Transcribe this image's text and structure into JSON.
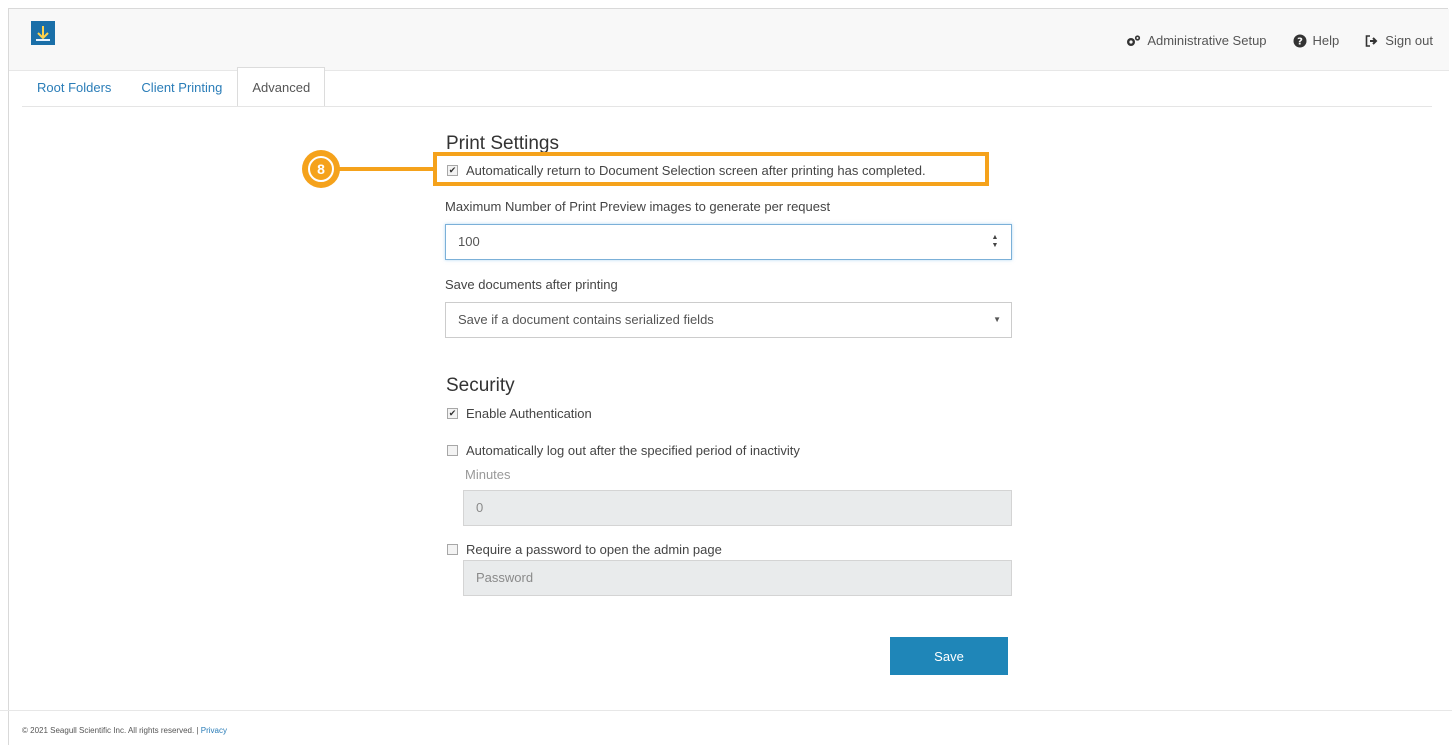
{
  "header": {
    "nav": {
      "admin_setup": "Administrative Setup",
      "help": "Help",
      "sign_out": "Sign out"
    }
  },
  "tabs": [
    {
      "label": "Root Folders"
    },
    {
      "label": "Client Printing"
    },
    {
      "label": "Advanced"
    }
  ],
  "print_settings": {
    "title": "Print Settings",
    "auto_return_label": "Automatically return to Document Selection screen after printing has completed.",
    "max_preview_label": "Maximum Number of Print Preview images to generate per request",
    "max_preview_value": "100",
    "save_docs_label": "Save documents after printing",
    "save_docs_value": "Save if a document contains serialized fields"
  },
  "security": {
    "title": "Security",
    "enable_auth_label": "Enable Authentication",
    "auto_logout_label": "Automatically log out after the specified period of inactivity",
    "minutes_label": "Minutes",
    "minutes_value": "0",
    "require_password_label": "Require a password to open the admin page",
    "password_placeholder": "Password"
  },
  "callout": {
    "number": "8"
  },
  "save_label": "Save",
  "footer": {
    "copyright": "© 2021 Seagull Scientific Inc. All rights reserved.",
    "separator": "|",
    "privacy": "Privacy"
  },
  "colors": {
    "accent": "#1f86b8",
    "highlight": "#f5a21b"
  }
}
